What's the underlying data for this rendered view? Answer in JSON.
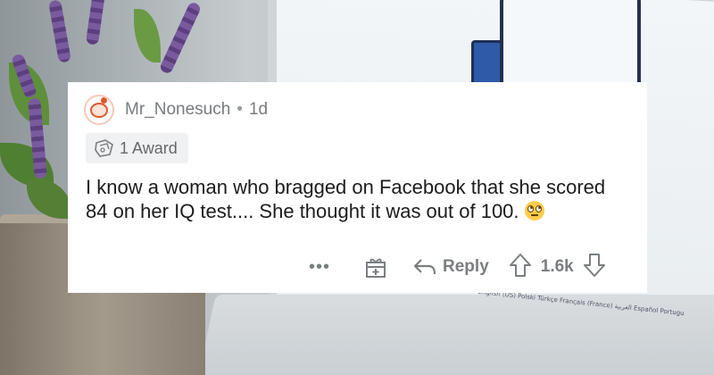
{
  "comment": {
    "username": "Mr_Nonesuch",
    "separator": "•",
    "age": "1d",
    "award_label": "1 Award",
    "text": "I know a woman who bragged on Facebook that she scored 84 on her IQ test.... She thought it was out of 100.",
    "emoji_icon": "face-with-rolling-eyes-icon"
  },
  "actions": {
    "more_label": "•••",
    "reply_label": "Reply",
    "score": "1.6k"
  },
  "background": {
    "keyboard_text": "English (US) Polski Türkçe Français (France) العربية Español Portugu"
  },
  "colors": {
    "card_background": "#ffffff",
    "meta_text": "#777b7e",
    "body_text": "#1c1c1c",
    "award_chip": "#f0f1f2",
    "avatar_accent": "#e2572c"
  }
}
